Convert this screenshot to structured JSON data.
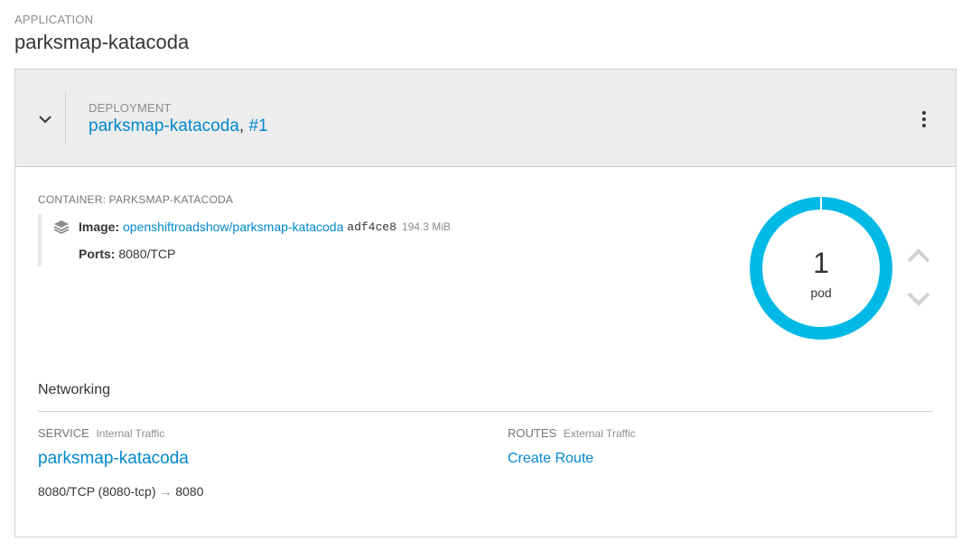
{
  "application": {
    "label": "APPLICATION",
    "name": "parksmap-katacoda"
  },
  "deployment": {
    "label": "DEPLOYMENT",
    "name": "parksmap-katacoda",
    "separator": ",",
    "revision": "#1"
  },
  "container": {
    "label": "CONTAINER: PARKSMAP-KATACODA",
    "image_label": "Image:",
    "image_name": "openshiftroadshow/parksmap-katacoda",
    "image_hash": "adf4ce8",
    "image_size": "194.3 MiB",
    "ports_label": "Ports:",
    "ports_value": "8080/TCP"
  },
  "pods": {
    "count": "1",
    "label": "pod",
    "ring_color": "#00b9e4"
  },
  "networking": {
    "title": "Networking",
    "service": {
      "heading": "SERVICE",
      "sub": "Internal Traffic",
      "name": "parksmap-katacoda",
      "ports_from": "8080/TCP (8080-tcp)",
      "arrow": "→",
      "ports_to": "8080"
    },
    "routes": {
      "heading": "ROUTES",
      "sub": "External Traffic",
      "create_label": "Create Route"
    }
  },
  "icons": {
    "collapse": "chevron-down-icon",
    "menu": "kebab-icon",
    "image": "layers-icon",
    "scale_up": "chevron-up-icon",
    "scale_down": "chevron-down-icon"
  },
  "colors": {
    "link": "#0088ce",
    "header_bg": "#ededed",
    "ring": "#00b9e4"
  }
}
